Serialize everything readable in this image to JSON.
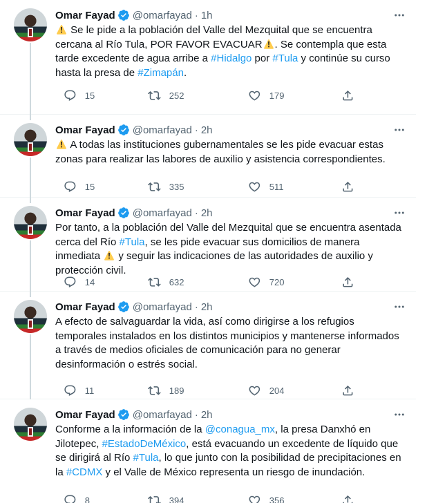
{
  "tweets": [
    {
      "name": "Omar Fayad",
      "handle": "@omarfayad",
      "time": "1h",
      "parts": [
        {
          "t": "warn"
        },
        {
          "t": "text",
          "v": " Se le pide a la población del Valle del Mezquital que se encuentra cercana al Río Tula, POR FAVOR EVACUAR"
        },
        {
          "t": "warn"
        },
        {
          "t": "text",
          "v": ". Se contempla que esta tarde excedente de agua arribe a "
        },
        {
          "t": "link",
          "v": "#Hidalgo"
        },
        {
          "t": "text",
          "v": " por "
        },
        {
          "t": "link",
          "v": "#Tula"
        },
        {
          "t": "text",
          "v": " y continúe su curso hasta la presa de "
        },
        {
          "t": "link",
          "v": "#Zimapán"
        },
        {
          "t": "text",
          "v": "."
        }
      ],
      "replies": "15",
      "retweets": "252",
      "likes": "179"
    },
    {
      "name": "Omar Fayad",
      "handle": "@omarfayad",
      "time": "2h",
      "parts": [
        {
          "t": "warn"
        },
        {
          "t": "text",
          "v": " A todas las instituciones gubernamentales se les pide evacuar estas zonas para realizar las labores de auxilio y asistencia correspondientes."
        }
      ],
      "replies": "15",
      "retweets": "335",
      "likes": "511"
    },
    {
      "name": "Omar Fayad",
      "handle": "@omarfayad",
      "time": "2h",
      "parts": [
        {
          "t": "text",
          "v": "Por tanto, a la población del Valle del Mezquital que se encuentra asentada cerca del Río "
        },
        {
          "t": "link",
          "v": "#Tula"
        },
        {
          "t": "text",
          "v": ", se les pide evacuar sus domicilios de manera inmediata "
        },
        {
          "t": "warn"
        },
        {
          "t": "text",
          "v": " y seguir las indicaciones de las autoridades de auxilio y protección civil."
        }
      ],
      "replies": "14",
      "retweets": "632",
      "likes": "720"
    },
    {
      "name": "Omar Fayad",
      "handle": "@omarfayad",
      "time": "2h",
      "parts": [
        {
          "t": "text",
          "v": "A efecto de salvaguardar la vida, así como dirigirse a los refugios temporales instalados en los distintos municipios y mantenerse informados a través de medios oficiales de comunicación para no generar desinformación o estrés social."
        }
      ],
      "replies": "11",
      "retweets": "189",
      "likes": "204"
    },
    {
      "name": "Omar Fayad",
      "handle": "@omarfayad",
      "time": "2h",
      "parts": [
        {
          "t": "text",
          "v": "Conforme a la información de la "
        },
        {
          "t": "link",
          "v": "@conagua_mx"
        },
        {
          "t": "text",
          "v": ", la presa Danxhó en Jilotepec, "
        },
        {
          "t": "link",
          "v": "#EstadoDeMéxico"
        },
        {
          "t": "text",
          "v": ", está evacuando un excedente de líquido que se dirigirá al Río "
        },
        {
          "t": "link",
          "v": "#Tula"
        },
        {
          "t": "text",
          "v": ", lo que junto con la posibilidad de precipitaciones en la "
        },
        {
          "t": "link",
          "v": "#CDMX"
        },
        {
          "t": "text",
          "v": " y el Valle de México representa un riesgo de inundación."
        }
      ],
      "replies": "8",
      "retweets": "394",
      "likes": "356"
    }
  ],
  "colors": {
    "link": "#1d9bf0",
    "verified": "#1d9bf0",
    "muted": "#536471",
    "text": "#0f1419",
    "warning": "#ffcc4d"
  },
  "icons": [
    "verified-badge-icon",
    "more-options-icon",
    "reply-icon",
    "retweet-icon",
    "like-icon",
    "share-icon",
    "warning-icon"
  ]
}
